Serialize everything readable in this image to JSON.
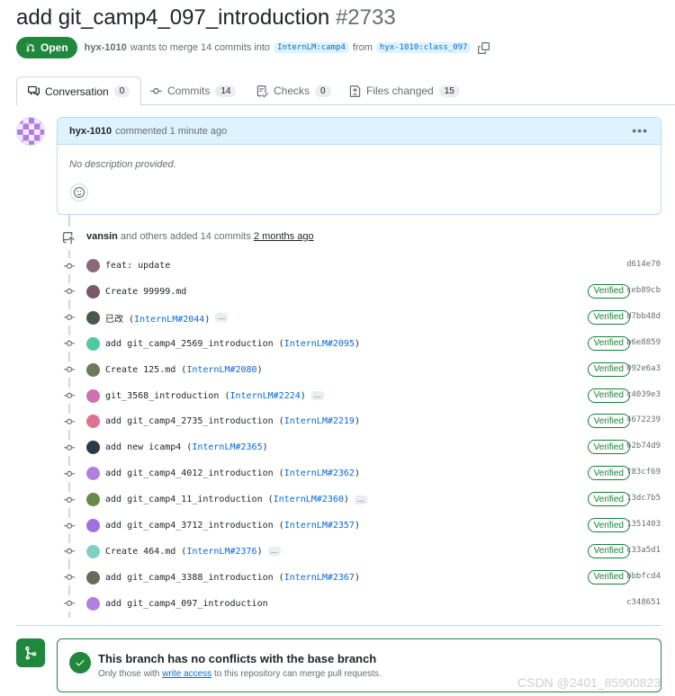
{
  "pr": {
    "title": "add git_camp4_097_introduction",
    "number": "#2733",
    "state": "Open",
    "author": "hyx-1010",
    "merge_text_1": "wants to merge 14 commits into",
    "base_branch": "InternLM:camp4",
    "merge_text_2": "from",
    "head_branch": "hyx-1010:class_097"
  },
  "tabs": [
    {
      "label": "Conversation",
      "count": "0",
      "icon": "comment-discussion-icon"
    },
    {
      "label": "Commits",
      "count": "14",
      "icon": "git-commit-icon"
    },
    {
      "label": "Checks",
      "count": "0",
      "icon": "checklist-icon"
    },
    {
      "label": "Files changed",
      "count": "15",
      "icon": "file-diff-icon"
    }
  ],
  "comment": {
    "author": "hyx-1010",
    "action": "commented 1 minute ago",
    "body": "No description provided."
  },
  "push": {
    "author": "vansin",
    "text": "and others added 14 commits",
    "when": "2 months ago"
  },
  "commits": [
    {
      "msg": "feat: update",
      "ref": "",
      "verified": "",
      "sha": "d614e70",
      "ellipsis": "",
      "avatar_color": "#8a6a7a"
    },
    {
      "msg": "Create 99999.md",
      "ref": "",
      "verified": "Verified",
      "sha": "ceb89cb",
      "ellipsis": "",
      "avatar_color": "#7a5a6a"
    },
    {
      "msg": "已改 (",
      "ref": "InternLM#2044",
      "tail": ")",
      "verified": "Verified",
      "sha": "d7bb48d",
      "ellipsis": "…",
      "avatar_color": "#4a5a4a"
    },
    {
      "msg": "add git_camp4_2569_introduction (",
      "ref": "InternLM#2095",
      "tail": ")",
      "verified": "Verified",
      "sha": "b6e8859",
      "ellipsis": "",
      "avatar_color": "#4fc9a0"
    },
    {
      "msg": "Create 125.md (",
      "ref": "InternLM#2080",
      "tail": ")",
      "verified": "Verified",
      "sha": "092e6a3",
      "ellipsis": "",
      "avatar_color": "#6a7a5a"
    },
    {
      "msg": "git_3568_introduction (",
      "ref": "InternLM#2224",
      "tail": ")",
      "verified": "Verified",
      "sha": "c4039e3",
      "ellipsis": "…",
      "avatar_color": "#d070b0"
    },
    {
      "msg": "add git_camp4_2735_introduction (",
      "ref": "InternLM#2219",
      "tail": ")",
      "verified": "Verified",
      "sha": "4672239",
      "ellipsis": "",
      "avatar_color": "#e07090"
    },
    {
      "msg": "add new icamp4 (",
      "ref": "InternLM#2365",
      "tail": ")",
      "verified": "Verified",
      "sha": "62b74d9",
      "ellipsis": "",
      "avatar_color": "#2a3a4a"
    },
    {
      "msg": "add git_camp4_4012_introduction (",
      "ref": "InternLM#2362",
      "tail": ")",
      "verified": "Verified",
      "sha": "f83cf69",
      "ellipsis": "",
      "avatar_color": "#b080e0"
    },
    {
      "msg": "add git_camp4_11_introduction (",
      "ref": "InternLM#2360",
      "tail": ")",
      "verified": "Verified",
      "sha": "13dc7b5",
      "ellipsis": "…",
      "avatar_color": "#6a8a4a"
    },
    {
      "msg": "add git_camp4_3712_introduction (",
      "ref": "InternLM#2357",
      "tail": ")",
      "verified": "Verified",
      "sha": "1351403",
      "ellipsis": "",
      "avatar_color": "#a070e0"
    },
    {
      "msg": "Create 464.md (",
      "ref": "InternLM#2376",
      "tail": ")",
      "verified": "Verified",
      "sha": "c33a5d1",
      "ellipsis": "…",
      "avatar_color": "#80d0c0"
    },
    {
      "msg": "add git_camp4_3388_introduction (",
      "ref": "InternLM#2367",
      "tail": ")",
      "verified": "Verified",
      "sha": "bbbfcd4",
      "ellipsis": "",
      "avatar_color": "#6a6a5a"
    },
    {
      "msg": "add git_camp4_097_introduction",
      "ref": "",
      "verified": "",
      "sha": "c348651",
      "ellipsis": "",
      "avatar_color": "#b080e0"
    }
  ],
  "merge": {
    "title": "This branch has no conflicts with the base branch",
    "sub_1": "Only those with",
    "sub_link": "write access",
    "sub_2": "to this repository can merge pull requests."
  },
  "watermark": "CSDN @2401_85900823",
  "colors": {
    "accent_green": "#1f883d",
    "link_blue": "#0969da"
  }
}
